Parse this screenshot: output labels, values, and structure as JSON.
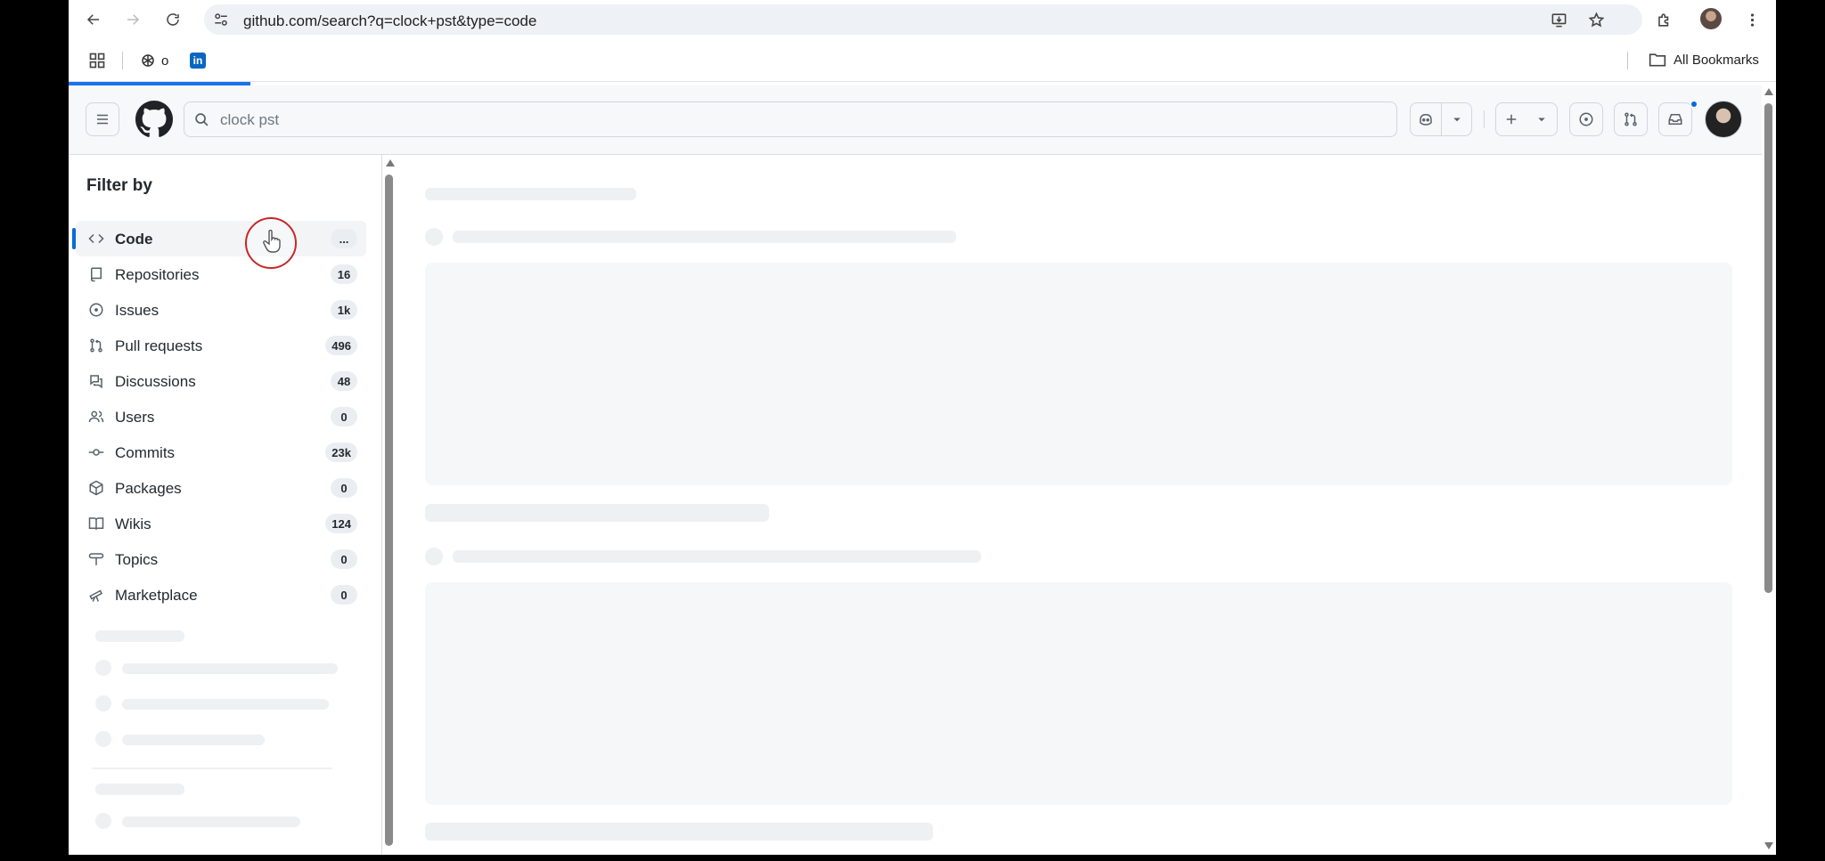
{
  "browser": {
    "url": "github.com/search?q=clock+pst&type=code",
    "bookmarks": [
      {
        "label": "o",
        "icon": "chatgpt-icon"
      },
      {
        "label": "",
        "icon": "linkedin-icon"
      }
    ],
    "all_bookmarks_label": "All Bookmarks",
    "loading_progress": 0.1
  },
  "github": {
    "search_query": "clock pst"
  },
  "sidebar": {
    "title": "Filter by",
    "items": [
      {
        "label": "Code",
        "count": "...",
        "icon": "code-icon",
        "active": true
      },
      {
        "label": "Repositories",
        "count": "16",
        "icon": "repo-icon"
      },
      {
        "label": "Issues",
        "count": "1k",
        "icon": "issue-icon"
      },
      {
        "label": "Pull requests",
        "count": "496",
        "icon": "pull-request-icon"
      },
      {
        "label": "Discussions",
        "count": "48",
        "icon": "discussion-icon"
      },
      {
        "label": "Users",
        "count": "0",
        "icon": "people-icon"
      },
      {
        "label": "Commits",
        "count": "23k",
        "icon": "commit-icon"
      },
      {
        "label": "Packages",
        "count": "0",
        "icon": "package-icon"
      },
      {
        "label": "Wikis",
        "count": "124",
        "icon": "book-icon"
      },
      {
        "label": "Topics",
        "count": "0",
        "icon": "topic-icon"
      },
      {
        "label": "Marketplace",
        "count": "0",
        "icon": "telescope-icon"
      }
    ]
  },
  "colors": {
    "accent": "#0969da",
    "loading_bar": "#1a73e8",
    "skeleton": "#eef0f2"
  }
}
